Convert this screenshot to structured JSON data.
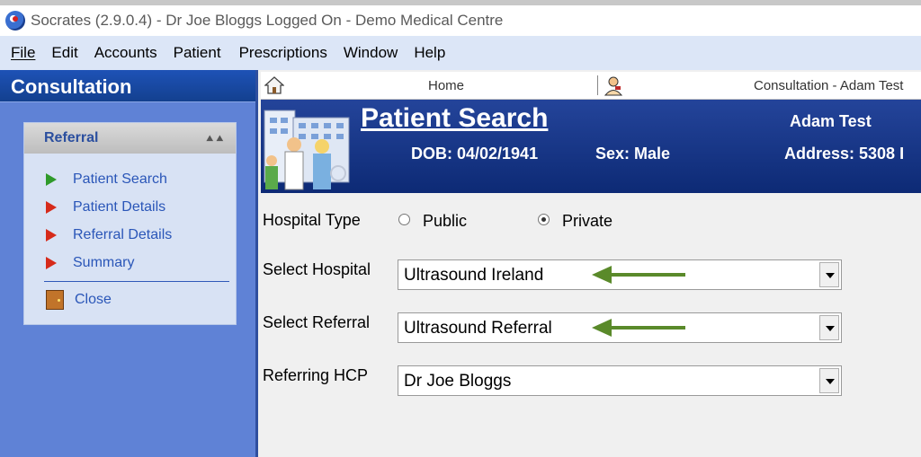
{
  "window": {
    "title": "Socrates (2.9.0.4) - Dr Joe Bloggs Logged On - Demo Medical Centre"
  },
  "menubar": {
    "items": [
      "File",
      "Edit",
      "Accounts",
      "Patient",
      "Prescriptions",
      "Window",
      "Help"
    ]
  },
  "sidebar": {
    "header": "Consultation",
    "panel_title": "Referral",
    "items": [
      "Patient Search",
      "Patient Details",
      "Referral Details",
      "Summary"
    ],
    "close_label": "Close"
  },
  "toolbar": {
    "home_label": "Home",
    "consult_label": "Consultation - Adam Test"
  },
  "banner": {
    "title": "Patient Search",
    "patient_name": "Adam Test",
    "dob": "DOB: 04/02/1941",
    "sex": "Sex: Male",
    "address": "Address: 5308 I"
  },
  "form": {
    "hospital_type_label": "Hospital Type",
    "public_label": "Public",
    "private_label": "Private",
    "selected_type": "Private",
    "select_hospital_label": "Select Hospital",
    "select_hospital_value": "Ultrasound Ireland",
    "select_referral_label": "Select Referral",
    "select_referral_value": "Ultrasound Referral",
    "referring_hcp_label": "Referring HCP",
    "referring_hcp_value": "Dr Joe Bloggs"
  },
  "colors": {
    "sidebar_bg": "#5f82d6",
    "banner_bg": "#0d2a75",
    "menubar_bg": "#dce6f7",
    "annotation_arrow": "#5a8a2a"
  }
}
